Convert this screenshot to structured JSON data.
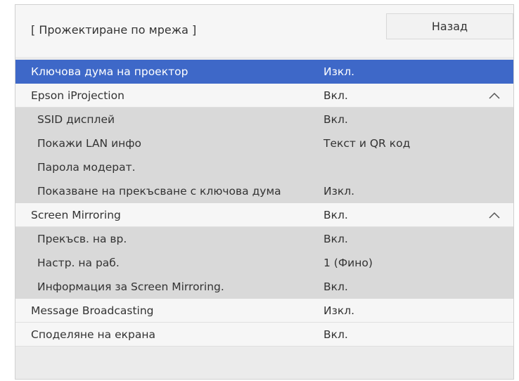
{
  "header": {
    "title": "[ Прожектиране по мрежа ]",
    "back_label": "Назад"
  },
  "colors": {
    "selected_row": "#3e68c8",
    "subitem_row": "#d9d9d9",
    "item_row": "#f6f6f6"
  },
  "menu": {
    "items": [
      {
        "label": "Ключова дума на проектор",
        "value": "Изкл."
      },
      {
        "label": "Epson iProjection",
        "value": "Вкл.",
        "expand_icon": "chevron-up-icon"
      },
      {
        "label": "SSID дисплей",
        "value": "Вкл."
      },
      {
        "label": "Покажи LAN инфо",
        "value": "Текст и QR код"
      },
      {
        "label": "Парола модерат.",
        "value": ""
      },
      {
        "label": "Показване на прекъсване с ключова дума",
        "value": "Изкл."
      },
      {
        "label": "Screen Mirroring",
        "value": "Вкл.",
        "expand_icon": "chevron-up-icon"
      },
      {
        "label": "Прекъсв. на вр.",
        "value": "Вкл."
      },
      {
        "label": "Настр. на раб.",
        "value": "1 (Фино)"
      },
      {
        "label": "Информация за Screen Mirroring.",
        "value": "Вкл."
      },
      {
        "label": "Message Broadcasting",
        "value": "Изкл."
      },
      {
        "label": "Споделяне на екрана",
        "value": "Вкл."
      }
    ]
  }
}
